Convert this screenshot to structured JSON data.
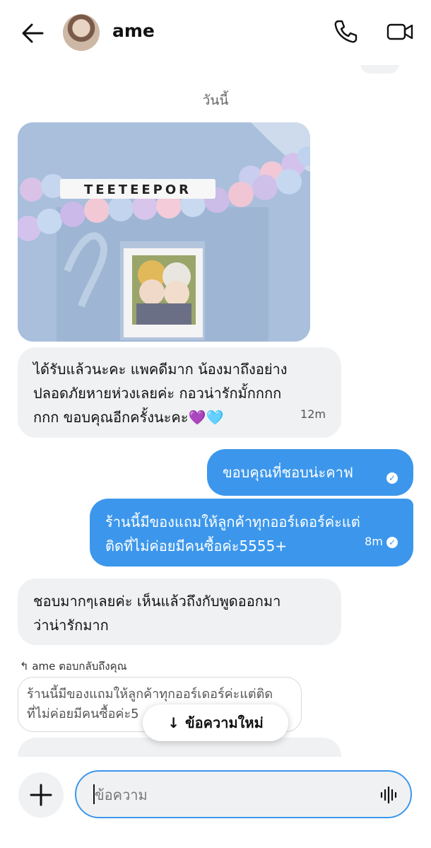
{
  "header": {
    "contact_name": "ame",
    "icons": [
      "back-arrow-icon",
      "avatar",
      "phone-icon",
      "video-camera-icon"
    ]
  },
  "date_divider": "วันนี้",
  "messages": [
    {
      "type": "image",
      "direction": "in",
      "image_text": "TEETEEPOR"
    },
    {
      "type": "text",
      "direction": "in",
      "lines": [
        "ได้รับแล้วนะคะ แพคดีมาก น้องมาถึงอย่าง",
        "ปลอดภัยหายห่วงเลยค่ะ กอวน่ารักมั้กกกก",
        "กกก ขอบคุณอีกครั้งนะคะ💜🩵"
      ],
      "time": "12m"
    },
    {
      "type": "text",
      "direction": "out",
      "lines": [
        "ขอบคุณที่ชอบน่ะคาฟ"
      ],
      "status": "seen"
    },
    {
      "type": "text",
      "direction": "out",
      "lines": [
        "ร้านนี้มีของแถมให้ลูกค้าทุกออร์เดอร์ค่ะแต่",
        "ติดที่ไม่ค่อยมีคนซื้อค่ะ5555+"
      ],
      "time": "8m",
      "status": "seen"
    },
    {
      "type": "text",
      "direction": "in",
      "lines": [
        "ชอบมากๆเลยค่ะ เห็นแล้วถึงกับพูดออกมา",
        "ว่าน่ารักมาก"
      ]
    }
  ],
  "reply": {
    "label": "ame ตอบกลับถึงคุณ",
    "quoted_lines": [
      "ร้านนี้มีของแถมให้ลูกค้าทุกออร์เดอร์ค่ะแต่ติด",
      "ที่ไม่ค่อยมีคนซื้อค่ะ5"
    ]
  },
  "new_message_button": {
    "label": "ข้อความใหม่",
    "icon": "arrow-down-icon"
  },
  "composer": {
    "placeholder": "ข้อความ",
    "icons": [
      "plus-icon",
      "audio-waveform-icon"
    ]
  },
  "colors": {
    "outgoing": "#3c97ec",
    "incoming": "#eff1f3"
  }
}
